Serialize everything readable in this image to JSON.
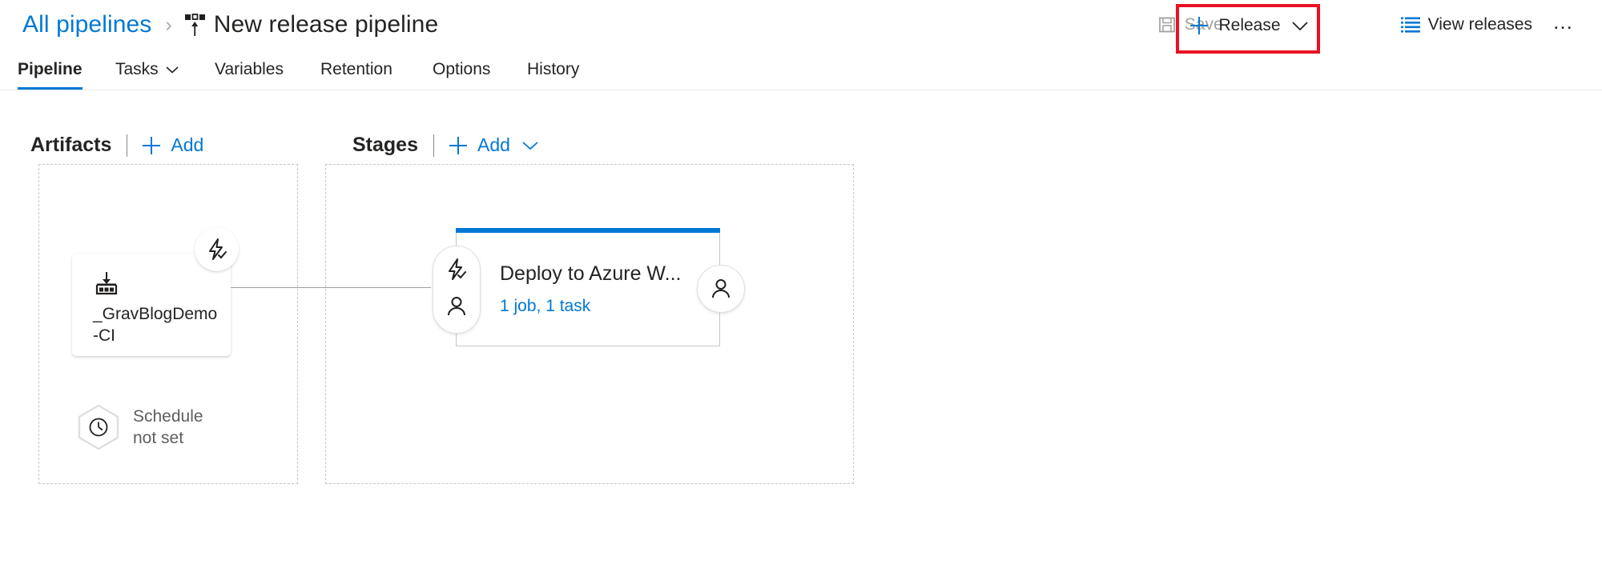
{
  "header": {
    "breadcrumb": {
      "parent_label": "All pipelines",
      "separator": "›",
      "pipeline_icon": "pipeline-icon",
      "title": "New release pipeline"
    },
    "toolbar": {
      "save_label": "Save",
      "save_icon": "save-icon",
      "release_label": "Release",
      "release_plus_icon": "plus-icon",
      "release_chevron_icon": "chevron-down-icon",
      "view_releases_label": "View releases",
      "view_releases_icon": "list-icon",
      "more_label": "…",
      "highlight_color": "#e81123"
    }
  },
  "tabs": [
    {
      "label": "Pipeline",
      "active": true
    },
    {
      "label": "Tasks",
      "active": false,
      "has_chevron": true
    },
    {
      "label": "Variables",
      "active": false
    },
    {
      "label": "Retention",
      "active": false
    },
    {
      "label": "Options",
      "active": false
    },
    {
      "label": "History",
      "active": false
    }
  ],
  "artifacts_panel": {
    "title": "Artifacts",
    "add_label": "Add",
    "add_icon": "plus-icon",
    "card": {
      "name": "_GravBlogDemo-CI",
      "icon": "build-artifact-icon",
      "trigger_badge_icon": "continuous-deployment-trigger-icon"
    },
    "schedule": {
      "icon": "clock-icon",
      "line1": "Schedule",
      "line2": "not set"
    }
  },
  "stages_panel": {
    "title": "Stages",
    "add_label": "Add",
    "add_icon": "plus-icon",
    "add_chevron_icon": "chevron-down-icon",
    "stage": {
      "name": "Deploy to Azure W...",
      "summary": "1 job, 1 task",
      "accent_color": "#0078d4",
      "pre_deploy_icons": [
        "pre-deployment-trigger-icon",
        "pre-deployment-approval-icon"
      ],
      "post_deploy_icon": "post-deployment-approval-icon"
    }
  },
  "colors": {
    "link": "#0078d4",
    "text": "#252423",
    "muted": "#605e5c",
    "disabled": "#a19f9d",
    "panel_border": "#c8c6c4"
  }
}
